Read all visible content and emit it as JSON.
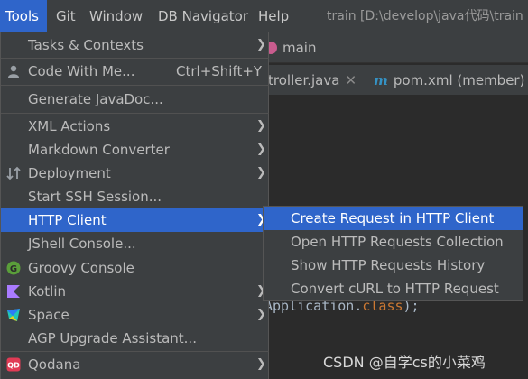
{
  "menubar": {
    "tools": "Tools",
    "git": "Git",
    "window": "Window",
    "db_navigator": "DB Navigator",
    "help": "Help",
    "title": "train [D:\\develop\\java代码\\train"
  },
  "editor": {
    "branch": "main",
    "tab1": "troller.java",
    "tab2": "pom.xml (member)",
    "code_line_a": "Application.",
    "code_line_b": "class",
    "code_line_c": ");"
  },
  "tools_menu": {
    "items": [
      {
        "label": "Tasks & Contexts",
        "icon": "",
        "shortcut": "",
        "submenu": true
      },
      {
        "label": "Code With Me...",
        "icon": "user-icon",
        "shortcut": "Ctrl+Shift+Y",
        "submenu": false
      },
      {
        "label": "Generate JavaDoc...",
        "icon": "",
        "shortcut": "",
        "submenu": false
      },
      {
        "label": "XML Actions",
        "icon": "",
        "shortcut": "",
        "submenu": true
      },
      {
        "label": "Markdown Converter",
        "icon": "",
        "shortcut": "",
        "submenu": true
      },
      {
        "label": "Deployment",
        "icon": "deployment-icon",
        "shortcut": "",
        "submenu": true
      },
      {
        "label": "Start SSH Session...",
        "icon": "",
        "shortcut": "",
        "submenu": false
      },
      {
        "label": "HTTP Client",
        "icon": "",
        "shortcut": "",
        "submenu": true
      },
      {
        "label": "JShell Console...",
        "icon": "",
        "shortcut": "",
        "submenu": false
      },
      {
        "label": "Groovy Console",
        "icon": "groovy-icon",
        "shortcut": "",
        "submenu": false
      },
      {
        "label": "Kotlin",
        "icon": "kotlin-icon",
        "shortcut": "",
        "submenu": true
      },
      {
        "label": "Space",
        "icon": "space-icon",
        "shortcut": "",
        "submenu": true
      },
      {
        "label": "AGP Upgrade Assistant...",
        "icon": "",
        "shortcut": "",
        "submenu": false
      },
      {
        "label": "Qodana",
        "icon": "qodana-icon",
        "shortcut": "",
        "submenu": true
      }
    ]
  },
  "http_submenu": {
    "items": [
      "Create Request in HTTP Client",
      "Open HTTP Requests Collection",
      "Show HTTP Requests History",
      "Convert cURL to HTTP Request"
    ]
  },
  "watermark": "CSDN @自学cs的小菜鸡",
  "colors": {
    "menu_bg": "#3c3f41",
    "selection": "#2f65ca",
    "editor_bg": "#2b2b2b",
    "text": "#bbbbbb"
  }
}
